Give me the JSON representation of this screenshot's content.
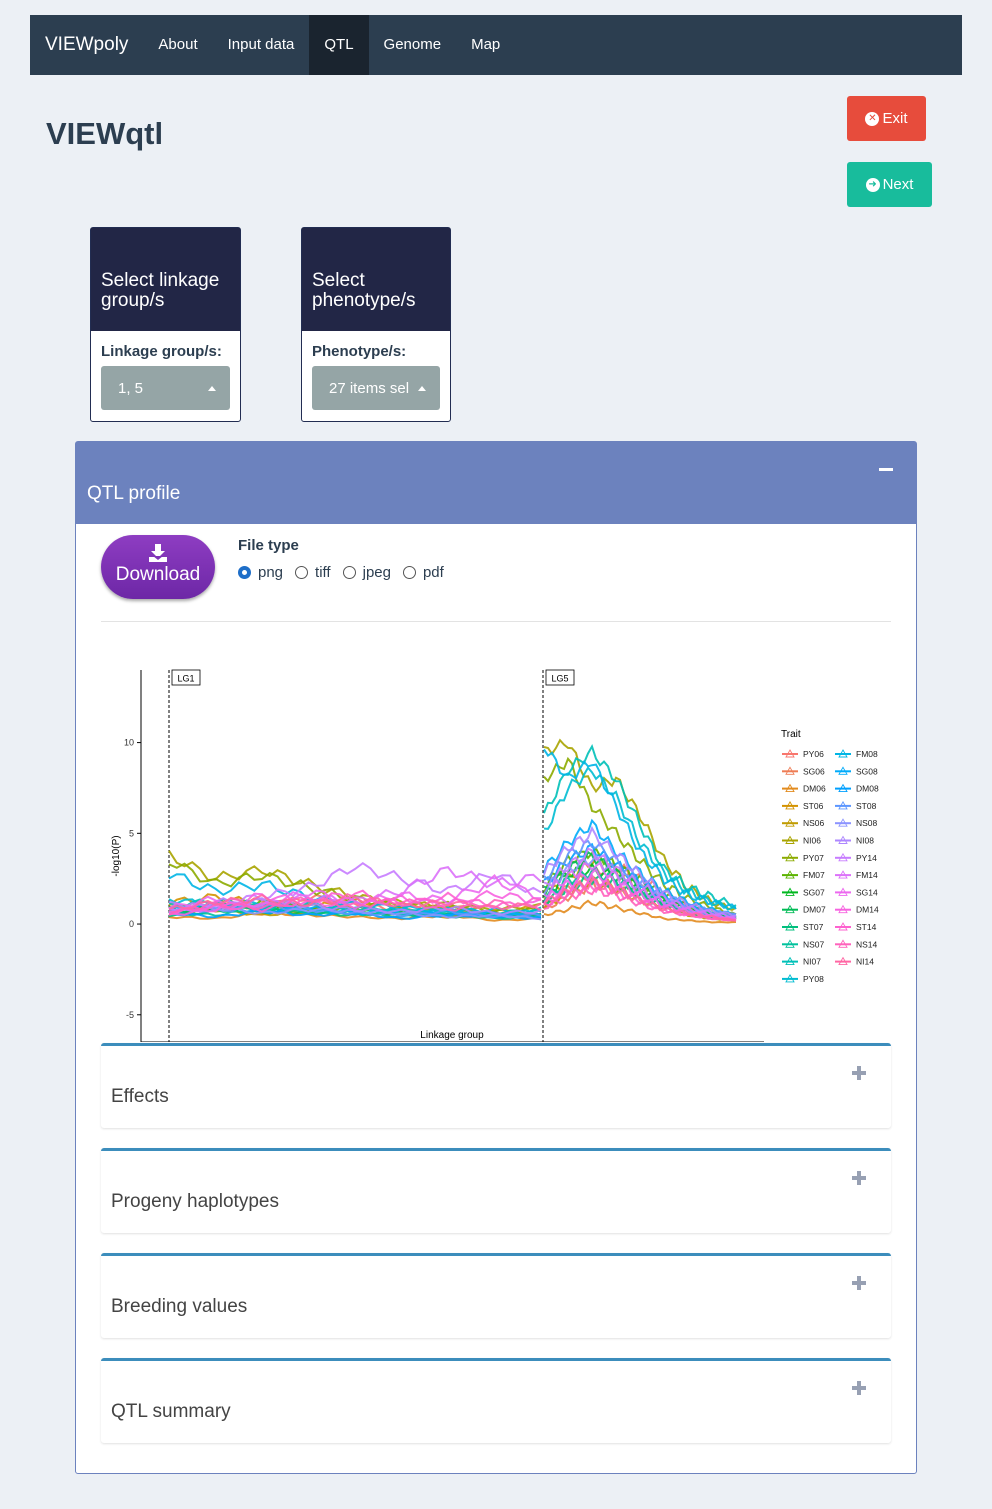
{
  "navbar": {
    "brand": "VIEWpoly",
    "items": [
      {
        "label": "About",
        "active": false
      },
      {
        "label": "Input data",
        "active": false
      },
      {
        "label": "QTL",
        "active": true
      },
      {
        "label": "Genome",
        "active": false
      },
      {
        "label": "Map",
        "active": false
      }
    ]
  },
  "page_title": "VIEWqtl",
  "buttons": {
    "exit": "Exit",
    "next": "Next"
  },
  "linkage_box": {
    "title": "Select linkage group/s",
    "label": "Linkage group/s:",
    "value": "1, 5"
  },
  "phenotype_box": {
    "title": "Select phenotype/s",
    "label": "Phenotype/s:",
    "value": "27 items sel"
  },
  "qtl_profile": {
    "title": "QTL profile",
    "download_label": "Download",
    "file_type_label": "File type",
    "file_types": [
      "png",
      "tiff",
      "jpeg",
      "pdf"
    ],
    "selected_file_type": "png"
  },
  "chart_data": {
    "type": "line",
    "xlabel": "Linkage group",
    "ylabel": "-log10(P)",
    "ylim": [
      -6.5,
      14
    ],
    "yticks": [
      -5,
      0,
      5,
      10
    ],
    "panels": [
      "LG1",
      "LG5"
    ],
    "legend_title": "Trait",
    "legend_position": "right",
    "series": [
      {
        "name": "PY06",
        "color": "#f8766d",
        "lg1": [
          0.8,
          1.2,
          0.9,
          1.5,
          1.1,
          0.7,
          1.0,
          0.6,
          0.5
        ],
        "lg5": [
          1.0,
          2.0,
          2.8,
          3.2,
          2.5,
          1.8,
          0.9,
          0.5,
          0.3
        ]
      },
      {
        "name": "SG06",
        "color": "#ee7d55",
        "lg1": [
          0.5,
          0.9,
          1.3,
          1.0,
          0.8,
          0.6,
          0.9,
          0.4,
          0.5
        ],
        "lg5": [
          0.8,
          1.5,
          2.2,
          1.9,
          1.4,
          1.0,
          0.6,
          0.4,
          0.2
        ]
      },
      {
        "name": "DM06",
        "color": "#e28b1e",
        "lg1": [
          0.4,
          0.3,
          0.6,
          0.5,
          0.4,
          0.3,
          0.5,
          0.2,
          0.3
        ],
        "lg5": [
          0.5,
          0.8,
          1.2,
          0.9,
          0.6,
          0.3,
          0.2,
          0.1,
          0.1
        ]
      },
      {
        "name": "ST06",
        "color": "#d39200",
        "lg1": [
          1.2,
          1.5,
          1.1,
          0.9,
          1.3,
          1.0,
          0.8,
          0.7,
          0.9
        ],
        "lg5": [
          1.5,
          2.5,
          3.5,
          2.9,
          2.0,
          1.2,
          0.7,
          0.4,
          0.3
        ]
      },
      {
        "name": "NS06",
        "color": "#c09b00",
        "lg1": [
          0.6,
          0.8,
          0.5,
          0.7,
          0.9,
          0.5,
          0.4,
          0.6,
          0.5
        ],
        "lg5": [
          0.9,
          1.8,
          2.4,
          2.0,
          1.3,
          0.9,
          0.5,
          0.3,
          0.2
        ]
      },
      {
        "name": "NI06",
        "color": "#a9a400",
        "lg1": [
          3.8,
          2.5,
          3.0,
          2.2,
          1.5,
          1.2,
          0.9,
          0.8,
          1.0
        ],
        "lg5": [
          9.5,
          10.0,
          7.5,
          8.0,
          6.0,
          3.5,
          2.0,
          1.2,
          0.8
        ]
      },
      {
        "name": "PY07",
        "color": "#8cab00",
        "lg1": [
          3.5,
          2.2,
          2.7,
          2.0,
          1.4,
          1.0,
          1.1,
          0.7,
          0.8
        ],
        "lg5": [
          8.0,
          9.0,
          6.5,
          5.0,
          3.5,
          2.2,
          1.4,
          0.9,
          0.5
        ]
      },
      {
        "name": "FM07",
        "color": "#5bb300",
        "lg1": [
          1.0,
          0.8,
          1.2,
          0.9,
          0.7,
          0.6,
          0.8,
          0.5,
          0.6
        ],
        "lg5": [
          2.0,
          3.5,
          4.0,
          3.2,
          2.4,
          1.6,
          1.0,
          0.6,
          0.4
        ]
      },
      {
        "name": "SG07",
        "color": "#00b81f",
        "lg1": [
          0.7,
          0.9,
          0.6,
          1.0,
          0.8,
          0.5,
          0.6,
          0.4,
          0.5
        ],
        "lg5": [
          1.5,
          2.8,
          3.0,
          2.6,
          1.8,
          1.2,
          0.8,
          0.5,
          0.3
        ]
      },
      {
        "name": "DM07",
        "color": "#00bc56",
        "lg1": [
          0.9,
          1.1,
          0.8,
          0.6,
          0.9,
          0.7,
          0.5,
          0.6,
          0.4
        ],
        "lg5": [
          1.8,
          3.0,
          3.8,
          2.8,
          2.0,
          1.3,
          0.9,
          0.5,
          0.4
        ]
      },
      {
        "name": "ST07",
        "color": "#00bf7d",
        "lg1": [
          0.5,
          0.7,
          0.9,
          0.6,
          0.5,
          0.7,
          0.4,
          0.5,
          0.3
        ],
        "lg5": [
          1.2,
          2.0,
          2.5,
          2.2,
          1.6,
          1.0,
          0.7,
          0.4,
          0.3
        ]
      },
      {
        "name": "NS07",
        "color": "#00c19c",
        "lg1": [
          0.6,
          0.5,
          0.8,
          0.7,
          0.6,
          0.4,
          0.6,
          0.3,
          0.4
        ],
        "lg5": [
          1.4,
          2.4,
          2.9,
          2.4,
          1.7,
          1.1,
          0.7,
          0.5,
          0.3
        ]
      },
      {
        "name": "NI07",
        "color": "#00c0b8",
        "lg1": [
          1.0,
          1.3,
          0.9,
          1.1,
          0.8,
          0.9,
          0.7,
          0.6,
          0.8
        ],
        "lg5": [
          6.0,
          8.5,
          9.5,
          8.0,
          5.5,
          3.0,
          2.0,
          1.5,
          1.0
        ]
      },
      {
        "name": "PY08",
        "color": "#00bcd1",
        "lg1": [
          1.4,
          1.0,
          1.2,
          0.8,
          0.9,
          0.6,
          0.8,
          0.5,
          0.7
        ],
        "lg5": [
          5.0,
          7.5,
          8.5,
          7.0,
          4.5,
          2.8,
          1.8,
          1.2,
          0.8
        ]
      },
      {
        "name": "FM08",
        "color": "#00b5e5",
        "lg1": [
          2.8,
          1.8,
          2.2,
          1.5,
          1.1,
          0.9,
          0.7,
          0.8,
          0.6
        ],
        "lg5": [
          9.8,
          8.0,
          9.0,
          6.5,
          4.0,
          2.5,
          1.6,
          1.2,
          0.9
        ]
      },
      {
        "name": "SG08",
        "color": "#00abfa",
        "lg1": [
          0.8,
          1.0,
          0.7,
          0.9,
          0.6,
          0.7,
          0.5,
          0.6,
          0.4
        ],
        "lg5": [
          3.0,
          4.5,
          5.5,
          4.0,
          2.8,
          1.8,
          1.2,
          0.8,
          0.5
        ]
      },
      {
        "name": "DM08",
        "color": "#00a0ff",
        "lg1": [
          0.6,
          0.4,
          0.7,
          0.5,
          0.6,
          0.3,
          0.5,
          0.4,
          0.3
        ],
        "lg5": [
          2.2,
          3.5,
          4.2,
          3.3,
          2.3,
          1.5,
          1.0,
          0.6,
          0.4
        ]
      },
      {
        "name": "ST08",
        "color": "#5c96ff",
        "lg1": [
          0.9,
          0.7,
          1.0,
          0.8,
          0.6,
          0.5,
          0.7,
          0.4,
          0.5
        ],
        "lg5": [
          2.5,
          3.8,
          4.5,
          3.5,
          2.4,
          1.6,
          1.0,
          0.7,
          0.5
        ]
      },
      {
        "name": "NS08",
        "color": "#8b93ff",
        "lg1": [
          0.7,
          0.9,
          0.6,
          0.8,
          0.7,
          0.6,
          0.4,
          0.5,
          0.3
        ],
        "lg5": [
          1.9,
          3.0,
          3.6,
          2.9,
          2.0,
          1.3,
          0.8,
          0.5,
          0.3
        ]
      },
      {
        "name": "NI08",
        "color": "#ae87ff",
        "lg1": [
          1.1,
          0.9,
          1.3,
          1.0,
          0.8,
          0.7,
          0.9,
          0.6,
          0.7
        ],
        "lg5": [
          2.8,
          4.2,
          5.0,
          3.9,
          2.7,
          1.7,
          1.1,
          0.7,
          0.5
        ]
      },
      {
        "name": "PY14",
        "color": "#c77cff",
        "lg1": [
          0.8,
          1.2,
          1.5,
          2.0,
          3.2,
          2.5,
          1.8,
          2.8,
          1.6
        ],
        "lg5": [
          2.0,
          3.2,
          4.0,
          3.0,
          2.1,
          1.4,
          0.9,
          0.6,
          0.4
        ]
      },
      {
        "name": "FM14",
        "color": "#dc71fa",
        "lg1": [
          0.6,
          0.9,
          1.1,
          1.5,
          1.3,
          1.8,
          3.0,
          2.2,
          2.6
        ],
        "lg5": [
          1.6,
          2.6,
          3.3,
          2.6,
          1.8,
          1.2,
          0.8,
          0.5,
          0.3
        ]
      },
      {
        "name": "SG14",
        "color": "#ec69ef",
        "lg1": [
          0.9,
          1.4,
          1.0,
          1.8,
          1.2,
          1.6,
          1.3,
          2.4,
          1.5
        ],
        "lg5": [
          1.3,
          2.2,
          2.8,
          2.3,
          1.6,
          1.0,
          0.7,
          0.4,
          0.3
        ]
      },
      {
        "name": "DM14",
        "color": "#f763e0",
        "lg1": [
          0.5,
          0.8,
          1.6,
          1.2,
          1.0,
          1.4,
          1.1,
          1.7,
          1.2
        ],
        "lg5": [
          1.1,
          1.9,
          2.4,
          2.0,
          1.4,
          0.9,
          0.6,
          0.4,
          0.2
        ]
      },
      {
        "name": "ST14",
        "color": "#fe61cf",
        "lg1": [
          0.7,
          1.0,
          0.8,
          1.3,
          1.7,
          1.1,
          1.5,
          1.0,
          1.3
        ],
        "lg5": [
          1.0,
          1.7,
          2.1,
          1.8,
          1.3,
          0.8,
          0.5,
          0.3,
          0.2
        ]
      },
      {
        "name": "NS14",
        "color": "#ff62bc",
        "lg1": [
          0.6,
          1.1,
          0.9,
          1.4,
          1.0,
          1.3,
          0.8,
          1.2,
          0.9
        ],
        "lg5": [
          0.9,
          1.5,
          1.9,
          1.6,
          1.1,
          0.7,
          0.5,
          0.3,
          0.2
        ]
      },
      {
        "name": "NI14",
        "color": "#ff67a4",
        "lg1": [
          0.8,
          1.2,
          1.4,
          1.1,
          1.5,
          1.0,
          1.2,
          0.9,
          1.1
        ],
        "lg5": [
          1.2,
          1.8,
          2.3,
          1.9,
          1.3,
          0.8,
          0.6,
          0.4,
          0.2
        ]
      }
    ]
  },
  "collapsed_sections": [
    {
      "title": "Effects"
    },
    {
      "title": "Progeny haplotypes"
    },
    {
      "title": "Breeding values"
    },
    {
      "title": "QTL summary"
    }
  ]
}
